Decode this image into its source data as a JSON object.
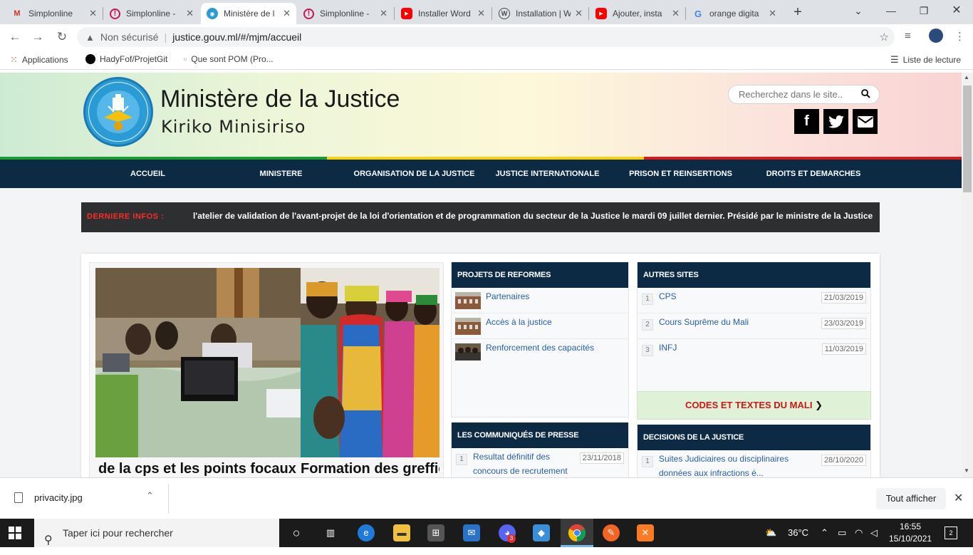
{
  "browser": {
    "tabs": [
      {
        "label": "Simplonline",
        "icon": "gmail-icon",
        "color": "#d93025",
        "glyph": "M"
      },
      {
        "label": "Simplonline -",
        "icon": "simplon-icon",
        "color": "#c2185b",
        "glyph": "!"
      },
      {
        "label": "Ministère de l",
        "icon": "ministry-favicon",
        "color": "#2b9bd6",
        "glyph": "◉",
        "active": true
      },
      {
        "label": "Simplonline -",
        "icon": "simplon-icon",
        "color": "#c2185b",
        "glyph": "!"
      },
      {
        "label": "Installer Word",
        "icon": "youtube-icon",
        "color": "#ff0000",
        "glyph": "▶"
      },
      {
        "label": "Installation | W",
        "icon": "wordpress-icon",
        "color": "#464646",
        "glyph": "W"
      },
      {
        "label": "Ajouter, insta",
        "icon": "youtube-icon",
        "color": "#ff0000",
        "glyph": "▶"
      },
      {
        "label": "orange digita",
        "icon": "google-icon",
        "color": "#4285f4",
        "glyph": "G"
      }
    ],
    "new_tab": "+",
    "address": {
      "security": "Non sécurisé",
      "url": "justice.gouv.ml/#/mjm/accueil"
    },
    "bookmarks": [
      {
        "label": "Applications",
        "icon": "apps-grid-icon"
      },
      {
        "label": "HadyFof/ProjetGit",
        "icon": "github-icon"
      },
      {
        "label": "Que sont POM (Pro...",
        "icon": "page-icon"
      }
    ],
    "reading_list": "Liste de lecture"
  },
  "site": {
    "title": "Ministère de la Justice",
    "subtitle": "Kiriko Minisiriso",
    "search_placeholder": "Recherchez dans le site..",
    "nav": [
      "ACCUEIL",
      "MINISTERE",
      "ORGANISATION DE LA JUSTICE",
      "JUSTICE INTERNATIONALE",
      "PRISON ET REINSERTIONS",
      "DROITS ET DEMARCHES"
    ],
    "ticker_label": "DERNIERE INFOS :",
    "ticker_text": "l'atelier de validation de l'avant-projet de la loi d'orientation et de programmation du secteur de la Justice le mardi 09 juillet dernier. Présidé par le ministre de la Justice et des Droits de",
    "slides": [
      {
        "caption": "de la cps et les points focaux"
      },
      {
        "caption": "Formation des greffier"
      }
    ],
    "reformes": {
      "title": "PROJETS DE REFORMES",
      "items": [
        "Partenaires",
        "Accès à la justice",
        "Renforcement des capacités"
      ]
    },
    "autres_sites": {
      "title": "AUTRES SITES",
      "items": [
        {
          "num": "1",
          "label": "CPS",
          "date": "21/03/2019"
        },
        {
          "num": "2",
          "label": "Cours Suprême du Mali",
          "date": "23/03/2019"
        },
        {
          "num": "3",
          "label": "INFJ",
          "date": "11/03/2019"
        }
      ]
    },
    "codes_label": "CODES ET TEXTES DU MALI",
    "communiques": {
      "title": "LES COMMUNIQUÉS DE PRESSE",
      "items": [
        {
          "num": "1",
          "label_line1": "Resultat définitif des",
          "label_line2": "concours de recrutement",
          "date": "23/11/2018"
        }
      ]
    },
    "decisions": {
      "title": "DECISIONS DE LA JUSTICE",
      "items": [
        {
          "num": "1",
          "label_line1": "Suites Judiciaires ou disciplinaires",
          "label_line2": "données aux infractions é...",
          "date": "28/10/2020"
        }
      ]
    }
  },
  "download": {
    "file": "privacity.jpg",
    "show_all": "Tout afficher"
  },
  "taskbar": {
    "search_placeholder": "Taper ici pour rechercher",
    "weather": "36°C",
    "time": "16:55",
    "date": "15/10/2021",
    "notifications": "2",
    "badge": "3"
  }
}
